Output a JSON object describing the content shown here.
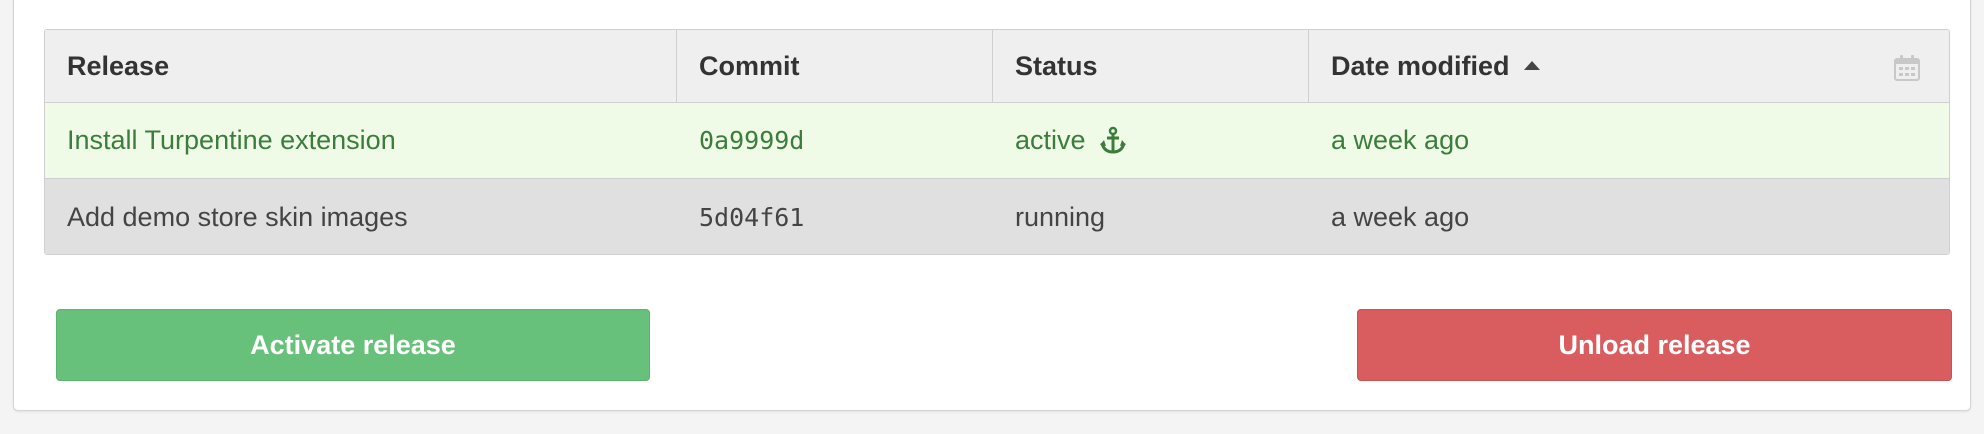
{
  "table": {
    "headers": {
      "release": "Release",
      "commit": "Commit",
      "status": "Status",
      "date_modified": "Date modified"
    },
    "rows": [
      {
        "release": "Install Turpentine extension",
        "commit": "0a9999d",
        "status": "active",
        "date": "a week ago",
        "highlighted": true
      },
      {
        "release": "Add demo store skin images",
        "commit": "5d04f61",
        "status": "running",
        "date": "a week ago",
        "highlighted": false
      }
    ]
  },
  "buttons": {
    "activate": "Activate release",
    "unload": "Unload release"
  },
  "colors": {
    "success_green": "#68c17a",
    "danger_red": "#d95c5f",
    "active_text": "#3c7d3c",
    "active_row_bg": "#effbe6"
  },
  "icons": {
    "sort": "sort-ascending-icon",
    "calendar": "calendar-icon",
    "status_active": "anchor-icon"
  }
}
